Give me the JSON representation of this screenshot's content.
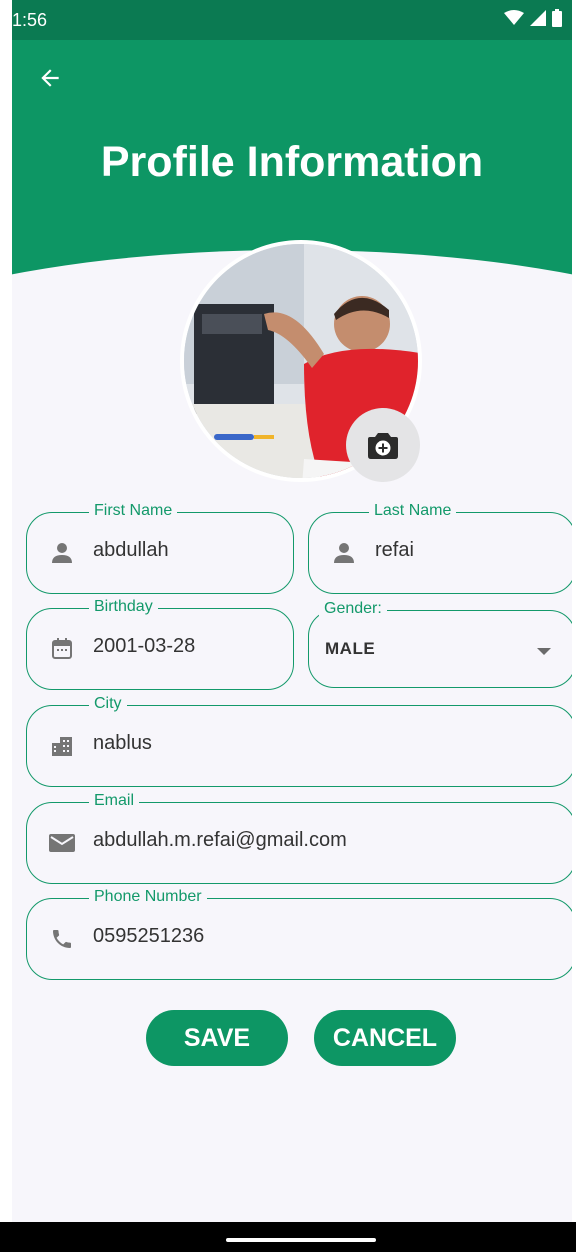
{
  "status_bar": {
    "time": "1:56"
  },
  "header": {
    "title": "Profile Information"
  },
  "form": {
    "first_name": {
      "label": "First Name",
      "value": "abdullah",
      "icon": "person-icon"
    },
    "last_name": {
      "label": "Last Name",
      "value": "refai",
      "icon": "person-icon"
    },
    "birthday": {
      "label": "Birthday",
      "value": "2001-03-28",
      "icon": "calendar-icon"
    },
    "gender": {
      "label": "Gender:",
      "value": "MALE"
    },
    "city": {
      "label": "City",
      "value": "nablus",
      "icon": "city-icon"
    },
    "email": {
      "label": "Email",
      "value": "abdullah.m.refai@gmail.com",
      "icon": "mail-icon"
    },
    "phone": {
      "label": "Phone Number",
      "value": "0595251236",
      "icon": "phone-icon"
    }
  },
  "actions": {
    "save_label": "SAVE",
    "cancel_label": "CANCEL"
  },
  "colors": {
    "primary": "#0d9664",
    "status_bar": "#0b7a52",
    "field_border": "#13996a",
    "background": "#f7f6fb"
  }
}
